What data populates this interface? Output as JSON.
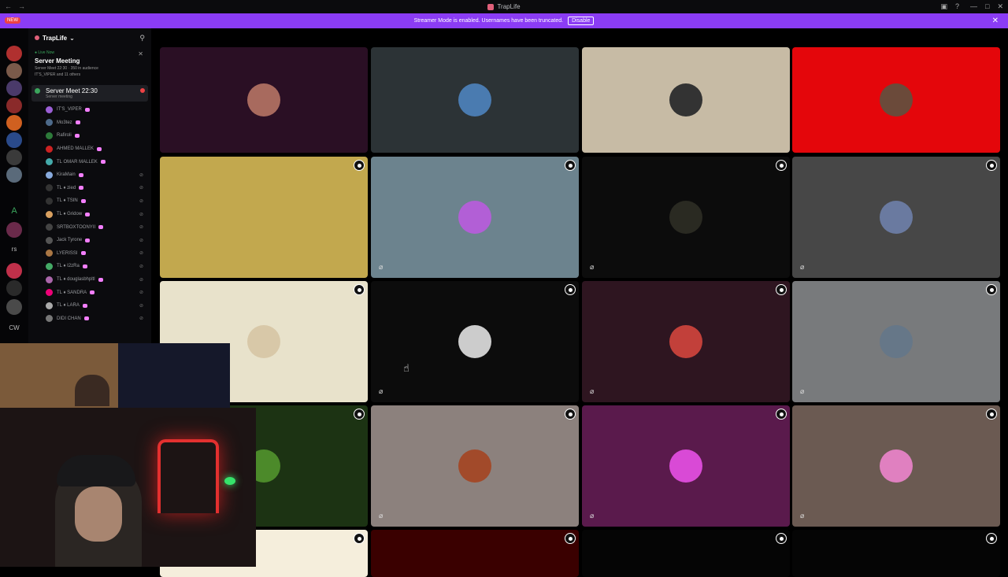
{
  "window": {
    "title": "TrapLife",
    "controls": [
      "—",
      "□",
      "✕"
    ]
  },
  "banner": {
    "text": "Streamer Mode is enabled. Usernames have been truncated.",
    "button": "Disable"
  },
  "rail": {
    "new_badge": "NEW",
    "letters": [
      "A",
      "rs",
      "CW"
    ]
  },
  "sidebar": {
    "server_name": "TrapLife",
    "live": {
      "label": "● Live Now",
      "title": "Server Meeting",
      "sub1": "Server Meet 22:30 · 350 in audience",
      "sub2": "IT'S_VIPER and 11 others"
    },
    "voice_channel": {
      "name": "Server Meet 22:30",
      "sub": "Server meeting"
    },
    "members": [
      {
        "name": "IT'S_VIPER",
        "color": "#9b5fd6"
      },
      {
        "name": "Mo3tez",
        "color": "#4d6a8a"
      },
      {
        "name": "Rafiroli",
        "color": "#2d7a3a"
      },
      {
        "name": "AHMED MALLEK",
        "color": "#c22"
      },
      {
        "name": "TL OMAR MALLEK",
        "color": "#4aa"
      },
      {
        "name": "KiraMain",
        "color": "#88aadd"
      },
      {
        "name": "TL ♦ zied",
        "color": "#333"
      },
      {
        "name": "TL ♦ TSIN",
        "color": "#333"
      },
      {
        "name": "TL ♦ Gridow",
        "color": "#d9a060"
      },
      {
        "name": "SRTBOXTOONYII",
        "color": "#444"
      },
      {
        "name": "Jack Tyrone",
        "color": "#555"
      },
      {
        "name": "LYERISSI",
        "color": "#aa7744"
      },
      {
        "name": "TL ♦ I2zRa",
        "color": "#4a6"
      },
      {
        "name": "TL ♦ douglasbhpltl",
        "color": "#a6a"
      },
      {
        "name": "TL ♦ SANDRA",
        "color": "#e07"
      },
      {
        "name": "TL ♦ LARA",
        "color": "#aaa"
      },
      {
        "name": "DIDI CHAN",
        "color": "#777"
      }
    ]
  },
  "grid": {
    "tiles": [
      {
        "bg": "#2a0f24",
        "avatar": "#a86a5e"
      },
      {
        "bg": "#2c3336",
        "avatar": "#4a7bb0"
      },
      {
        "bg": "#c7bba5",
        "avatar": "#333333"
      },
      {
        "bg": "#e4060b",
        "avatar": "#6b4a3a"
      },
      {
        "bg": "#c2a84e",
        "avatar": "#c2a84e"
      },
      {
        "bg": "#6c838e",
        "avatar": "#b25fd6"
      },
      {
        "bg": "#0c0c0c",
        "avatar": "#2a2a22"
      },
      {
        "bg": "#474747",
        "avatar": "#6a7aa0"
      },
      {
        "bg": "#e8e2cb",
        "avatar": "#d8c8a8"
      },
      {
        "bg": "#0c0c0c",
        "avatar": "#ccc"
      },
      {
        "bg": "#2e1520",
        "avatar": "#c2403a"
      },
      {
        "bg": "#787a7c",
        "avatar": "#667788"
      },
      {
        "bg": "#1c3313",
        "avatar": "#4c8a2a"
      },
      {
        "bg": "#8c817d",
        "avatar": "#a24a2a"
      },
      {
        "bg": "#5a1a4c",
        "avatar": "#d94ad6"
      },
      {
        "bg": "#6b5a52",
        "avatar": "#e080c0"
      },
      {
        "bg": "#f5eedc",
        "avatar": ""
      },
      {
        "bg": "#3a0000",
        "avatar": ""
      },
      {
        "bg": "#050505",
        "avatar": ""
      },
      {
        "bg": "#050505",
        "avatar": ""
      }
    ]
  }
}
